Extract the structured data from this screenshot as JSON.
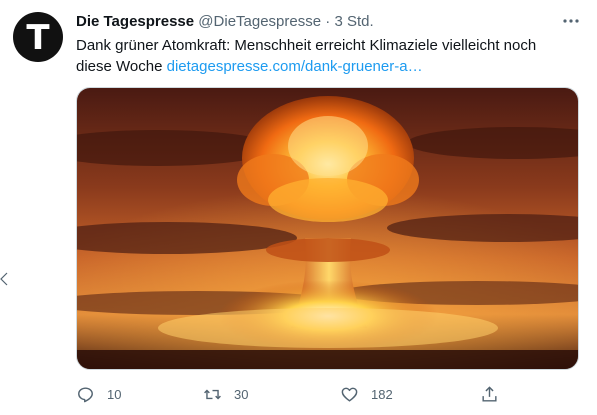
{
  "tweet": {
    "avatar_letter": "T",
    "author_name": "Die Tagespresse",
    "author_handle": "@DieTagespresse",
    "separator": "·",
    "time": "3 Std.",
    "text": "Dank grüner Atomkraft: Menschheit erreicht Klimaziele vielleicht noch diese Woche ",
    "link": "dietagespresse.com/dank-gruener-a…",
    "more_icon": "more-icon"
  },
  "actions": {
    "reply": {
      "icon": "reply-icon",
      "count": "10"
    },
    "retweet": {
      "icon": "retweet-icon",
      "count": "30"
    },
    "like": {
      "icon": "like-icon",
      "count": "182"
    },
    "share": {
      "icon": "share-icon"
    }
  },
  "colors": {
    "link": "#1d9bf0",
    "secondary_text": "#536471",
    "primary_text": "#0f1419"
  }
}
